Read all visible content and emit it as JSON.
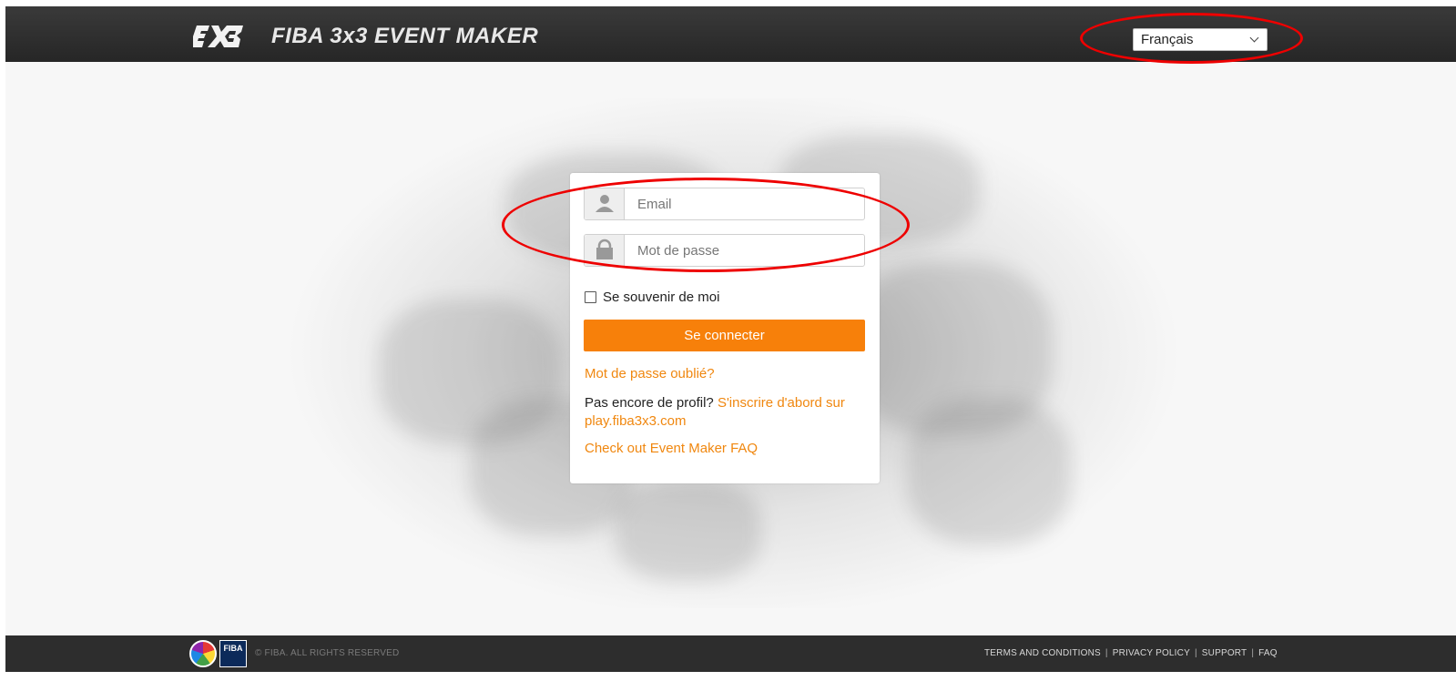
{
  "header": {
    "logo_alt": "3x3",
    "app_title": "FIBA 3x3 EVENT MAKER",
    "language": {
      "selected": "Français"
    }
  },
  "login": {
    "email_placeholder": "Email",
    "password_placeholder": "Mot de passe",
    "remember_label": "Se souvenir de moi",
    "submit_label": "Se connecter",
    "forgot_link": "Mot de passe oublié?",
    "signup_prefix": "Pas encore de profil?",
    "signup_link": "S'inscrire d'abord sur play.fiba3x3.com",
    "faq_link": "Check out Event Maker FAQ"
  },
  "footer": {
    "copyright": "© FIBA. ALL RIGHTS RESERVED",
    "fiba_badge": "FIBA",
    "links": [
      "TERMS AND CONDITIONS",
      "PRIVACY POLICY",
      "SUPPORT",
      "FAQ"
    ]
  },
  "colors": {
    "accent": "#f7800a",
    "link": "#f0870f",
    "header_bg": "#2f2f2f",
    "annotation": "#ee0000"
  },
  "icons": {
    "user": "user-icon",
    "lock": "lock-icon",
    "chevron": "chevron-down-icon"
  }
}
